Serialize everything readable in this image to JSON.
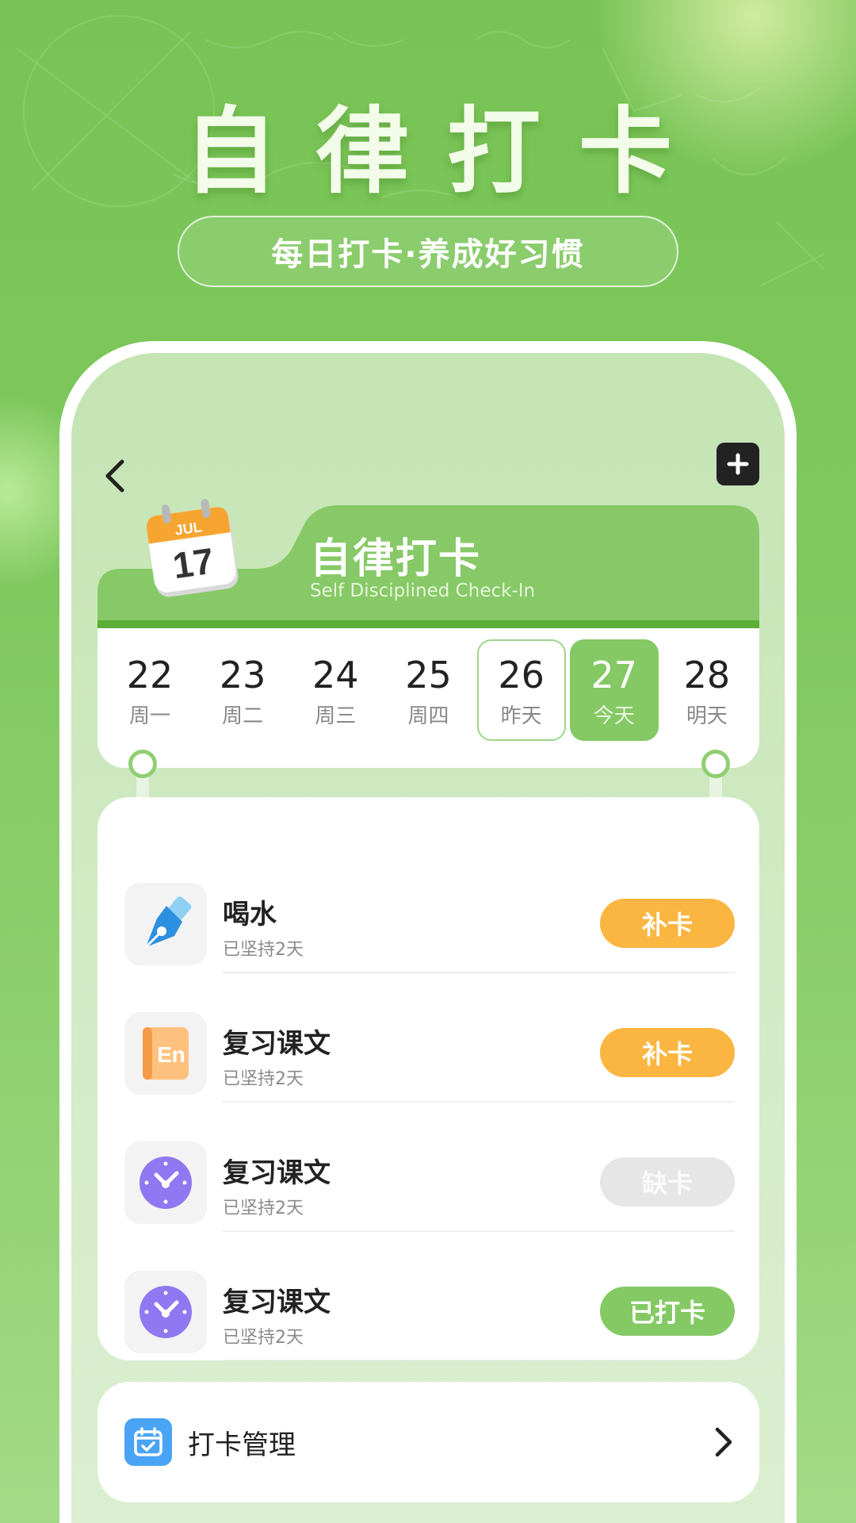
{
  "hero": {
    "title": "自律打卡",
    "subtitle": "每日打卡·养成好习惯"
  },
  "header": {
    "back_icon": "chevron-left-icon",
    "add_icon": "plus-icon",
    "title": "自律打卡",
    "subtitle": "Self Disciplined Check-In",
    "calendar_month": "JUL",
    "calendar_day": "17"
  },
  "week": [
    {
      "num": "22",
      "label": "周一",
      "state": "normal"
    },
    {
      "num": "23",
      "label": "周二",
      "state": "normal"
    },
    {
      "num": "24",
      "label": "周三",
      "state": "normal"
    },
    {
      "num": "25",
      "label": "周四",
      "state": "normal"
    },
    {
      "num": "26",
      "label": "昨天",
      "state": "yesterday"
    },
    {
      "num": "27",
      "label": "今天",
      "state": "today"
    },
    {
      "num": "28",
      "label": "明天",
      "state": "normal"
    }
  ],
  "tasks": [
    {
      "name": "喝水",
      "streak": "已坚持2天",
      "icon": "pen-icon",
      "button": "补卡",
      "status": "makeup"
    },
    {
      "name": "复习课文",
      "streak": "已坚持2天",
      "icon": "english-book-icon",
      "button": "补卡",
      "status": "makeup"
    },
    {
      "name": "复习课文",
      "streak": "已坚持2天",
      "icon": "clock-icon",
      "button": "缺卡",
      "status": "missed"
    },
    {
      "name": "复习课文",
      "streak": "已坚持2天",
      "icon": "clock-icon",
      "button": "已打卡",
      "status": "done"
    }
  ],
  "manage": {
    "label": "打卡管理",
    "icon": "calendar-check-icon"
  },
  "colors": {
    "brand_green": "#84c964",
    "makeup_orange": "#fbb541",
    "missed_gray": "#e6e6e6",
    "manage_blue": "#4aa4f5"
  }
}
